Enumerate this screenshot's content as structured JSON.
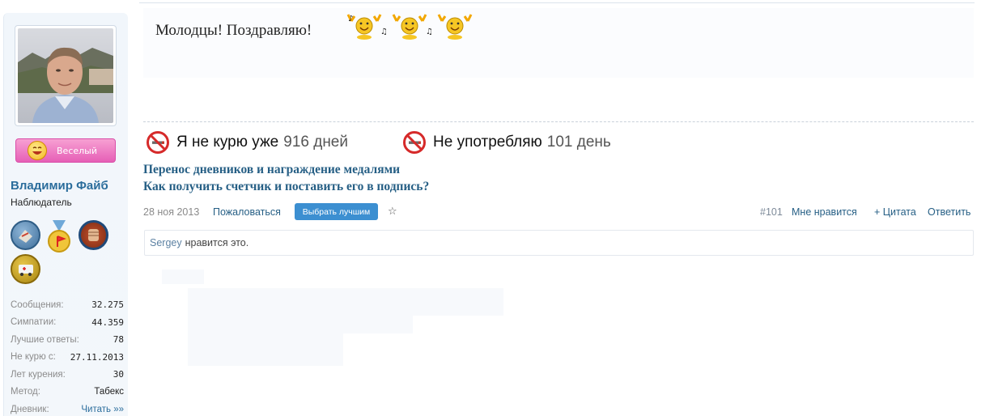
{
  "user": {
    "name": "Владимир Файб",
    "title": "Наблюдатель",
    "mood": "Веселый",
    "stats": [
      {
        "label": "Сообщения:",
        "value": "32.275"
      },
      {
        "label": "Симпатии:",
        "value": "44.359"
      },
      {
        "label": "Лучшие ответы:",
        "value": "78"
      },
      {
        "label": "Не курю с:",
        "value": "27.11.2013"
      },
      {
        "label": "Лет курения:",
        "value": "30"
      },
      {
        "label": "Метод:",
        "value": "Табекс"
      },
      {
        "label": "Дневник:",
        "value": "Читать »»"
      }
    ]
  },
  "message": {
    "text": "Молодцы! Поздравляю!"
  },
  "signature": {
    "counter1": {
      "text": "Я не курю уже",
      "number": "916 дней"
    },
    "counter2": {
      "text": "Не употребляю",
      "number": "101 день"
    },
    "links": [
      "Перенос дневников и награждение медалями",
      "Как получить счетчик и поставить его в подпись?"
    ]
  },
  "meta": {
    "date": "28 ноя 2013",
    "report": "Пожаловаться",
    "best": "Выбрать лучшим",
    "star": "☆",
    "post_number": "#101",
    "like": "Мне нравится",
    "quote": "+ Цитата",
    "reply": "Ответить"
  },
  "likes": {
    "user": "Sergey",
    "text": "нравится это."
  }
}
